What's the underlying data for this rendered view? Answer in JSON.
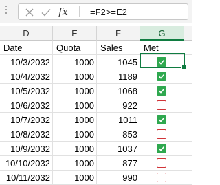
{
  "formula_bar": {
    "formula": "=F2>=E2",
    "fx_label": "fx"
  },
  "columns": [
    "D",
    "E",
    "F",
    "G"
  ],
  "header_row": {
    "date": "Date",
    "quota": "Quota",
    "sales": "Sales",
    "met": "Met"
  },
  "rows": [
    {
      "date": "10/3/2032",
      "quota": "1000",
      "sales": "1045",
      "met": true
    },
    {
      "date": "10/4/2032",
      "quota": "1000",
      "sales": "1189",
      "met": true
    },
    {
      "date": "10/5/2032",
      "quota": "1000",
      "sales": "1068",
      "met": true
    },
    {
      "date": "10/6/2032",
      "quota": "1000",
      "sales": "922",
      "met": false
    },
    {
      "date": "10/7/2032",
      "quota": "1000",
      "sales": "1011",
      "met": true
    },
    {
      "date": "10/8/2032",
      "quota": "1000",
      "sales": "853",
      "met": false
    },
    {
      "date": "10/9/2032",
      "quota": "1000",
      "sales": "1037",
      "met": true
    },
    {
      "date": "10/10/2032",
      "quota": "1000",
      "sales": "877",
      "met": false
    },
    {
      "date": "10/11/2032",
      "quota": "1000",
      "sales": "990",
      "met": false
    }
  ],
  "colors": {
    "checked": "#2fa84f",
    "unchecked_border": "#d13438",
    "selection": "#107c41"
  }
}
